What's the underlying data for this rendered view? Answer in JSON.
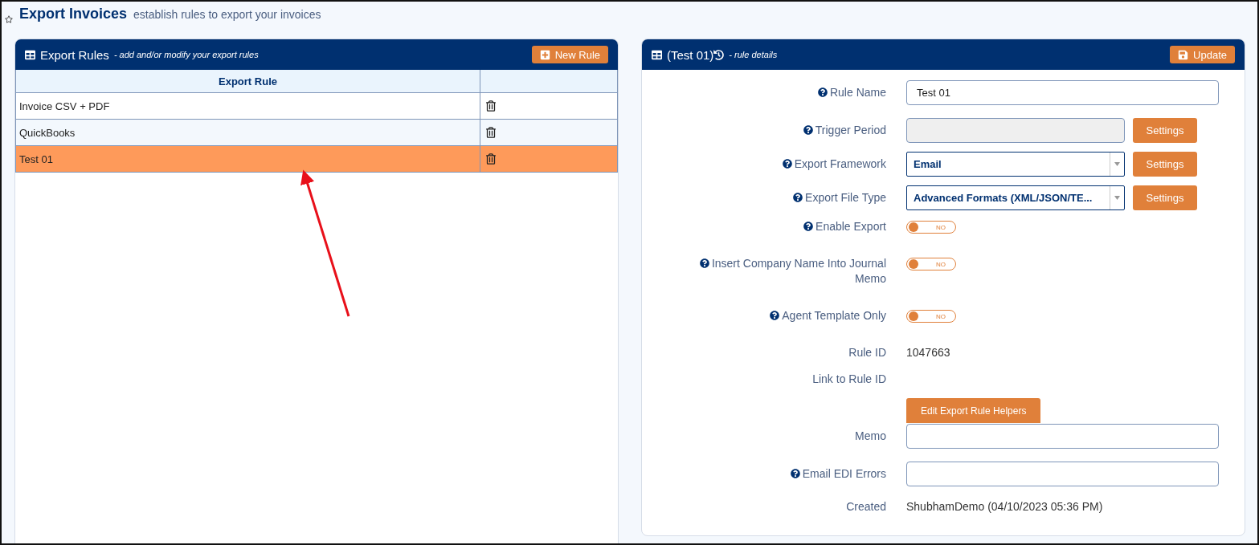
{
  "page": {
    "title": "Export Invoices",
    "subtitle": "establish rules to export your invoices"
  },
  "rules_panel": {
    "title": "Export Rules",
    "subtitle": "- add and/or modify your export rules",
    "new_button": "New Rule",
    "table": {
      "columns": [
        "Export Rule"
      ],
      "rows": [
        {
          "name": "Invoice CSV + PDF",
          "selected": false
        },
        {
          "name": "QuickBooks",
          "selected": false
        },
        {
          "name": "Test 01",
          "selected": true
        }
      ]
    }
  },
  "details_panel": {
    "title": "(Test 01)",
    "subtitle": "- rule details",
    "update_button": "Update",
    "fields": [
      {
        "kind": "input",
        "label": "Rule Name",
        "help": true,
        "value": "Test 01"
      },
      {
        "kind": "disabled_settings",
        "label": "Trigger Period",
        "help": true,
        "button": "Settings"
      },
      {
        "kind": "select_settings",
        "label": "Export Framework",
        "help": true,
        "value": "Email",
        "button": "Settings"
      },
      {
        "kind": "select_settings",
        "label": "Export File Type",
        "help": true,
        "value": "Advanced Formats (XML/JSON/TE...",
        "button": "Settings"
      },
      {
        "kind": "toggle",
        "label": "Enable Export",
        "help": true,
        "on": false,
        "toggle_text": "NO"
      },
      {
        "kind": "toggle",
        "label": "Insert Company Name Into Journal Memo",
        "help": true,
        "on": false,
        "toggle_text": "NO"
      },
      {
        "kind": "toggle",
        "label": "Agent Template Only",
        "help": true,
        "on": false,
        "toggle_text": "NO"
      },
      {
        "kind": "static",
        "label": "Rule ID",
        "help": false,
        "value": "1047663"
      },
      {
        "kind": "static",
        "label": "Link to Rule ID",
        "help": false
      },
      {
        "kind": "button",
        "button": "Edit Export Rule Helpers"
      },
      {
        "kind": "input",
        "label": "Memo",
        "help": false
      },
      {
        "kind": "input",
        "label": "Email EDI Errors",
        "help": true
      },
      {
        "kind": "static",
        "label": "Created",
        "help": false,
        "value": "ShubhamDemo (04/10/2023 05:36 PM)"
      }
    ]
  }
}
